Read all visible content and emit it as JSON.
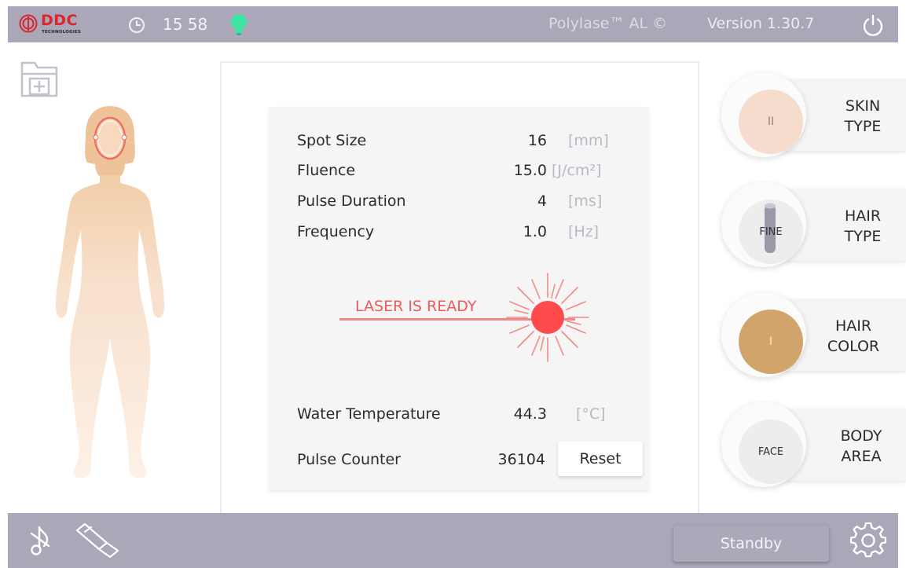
{
  "header": {
    "brand": "DDC",
    "brand_sub": "TECHNOLOGIES",
    "time": "15 58",
    "product": "Polylase™ AL ©",
    "version": "Version 1.30.7",
    "icons": [
      "ddc-logo-icon",
      "clock-icon",
      "status-light-icon",
      "power-icon"
    ],
    "status_color": "#3fe3a6"
  },
  "left": {
    "icons": [
      "new-file-icon",
      "body-figure"
    ],
    "selected_area_color": "#f06e5e"
  },
  "parameters": [
    {
      "label": "Spot Size",
      "value": "16",
      "unit": "[mm]"
    },
    {
      "label": "Fluence",
      "value": "15.0",
      "unit": "[J/cm²]"
    },
    {
      "label": "Pulse Duration",
      "value": "4",
      "unit": "[ms]"
    },
    {
      "label": "Frequency",
      "value": "1.0",
      "unit": "[Hz]"
    }
  ],
  "laser": {
    "status": "LASER IS READY",
    "color": "#ff4b4b"
  },
  "water": {
    "label": "Water Temperature",
    "value": "44.3",
    "unit": "[°C]"
  },
  "pulse_counter": {
    "label": "Pulse Counter",
    "value": "36104",
    "reset_label": "Reset"
  },
  "selectors": {
    "skin_type": {
      "value": "II",
      "line1": "SKIN",
      "line2": "TYPE",
      "color": "#f6dccc"
    },
    "hair_type": {
      "value": "FINE",
      "line1": "HAIR",
      "line2": "TYPE",
      "color": "#ededee"
    },
    "hair_color": {
      "value": "I",
      "line1": "HAIR",
      "line2": "COLOR",
      "color": "#d0a46a"
    },
    "body_area": {
      "value": "FACE",
      "line1": "BODY",
      "line2": "AREA",
      "color": "#ededee"
    }
  },
  "footer": {
    "standby_label": "Standby",
    "icons": [
      "audio-icon",
      "handpiece-icon",
      "gear-icon"
    ]
  }
}
